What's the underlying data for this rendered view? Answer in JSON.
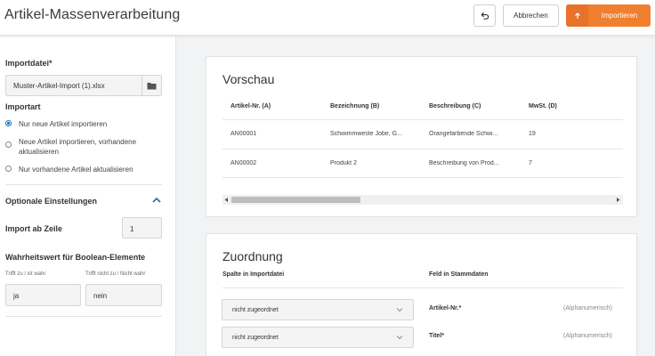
{
  "header": {
    "title": "Artikel-Massenverarbeitung",
    "cancel_label": "Abbrechen",
    "import_label": "Importieren"
  },
  "sidebar": {
    "import_file_label": "Importdatei*",
    "import_file_value": "Muster-Artikel-Import (1).xlsx",
    "import_type_label": "Importart",
    "import_options": [
      {
        "label": "Nur neue Artikel importieren",
        "selected": true
      },
      {
        "label_line1": "Neue Artikel importieren, vorhandene",
        "label_line2": "aktualisieren",
        "selected": false
      },
      {
        "label": "Nur vorhandene Artikel aktualisieren",
        "selected": false
      }
    ],
    "optional_settings_label": "Optionale Einstellungen",
    "import_from_row_label": "Import ab Zeile",
    "import_from_row_value": "1",
    "boolean_label": "Wahrheitswert für Boolean-Elemente",
    "true_label": "Trifft zu / ist wahr",
    "false_label": "Trifft nicht zu / Nicht wahr",
    "true_value": "ja",
    "false_value": "nein"
  },
  "preview": {
    "title": "Vorschau",
    "columns": [
      "Artikel-Nr. (A)",
      "Bezeichnung (B)",
      "Beschreibung (C)",
      "MwSt. (D)"
    ],
    "rows": [
      [
        "AN00001",
        "Schwimmweste Jobe, G...",
        "Orangefarbende Schwi...",
        "19"
      ],
      [
        "AN00002",
        "Produkt 2",
        "Beschreibung von Prod...",
        "7"
      ]
    ]
  },
  "mapping": {
    "title": "Zuordnung",
    "col_source": "Spalte in Importdatei",
    "col_target": "Feld in Stammdaten",
    "rows": [
      {
        "select_value": "nicht zugeordnet",
        "field": "Artikel-Nr.*",
        "type": "(Alphanumerisch)"
      },
      {
        "select_value": "nicht zugeordnet",
        "field": "Titel*",
        "type": "(Alphanumerisch)"
      }
    ]
  },
  "colors": {
    "accent": "#f07f2f",
    "radio": "#1a73c8"
  }
}
